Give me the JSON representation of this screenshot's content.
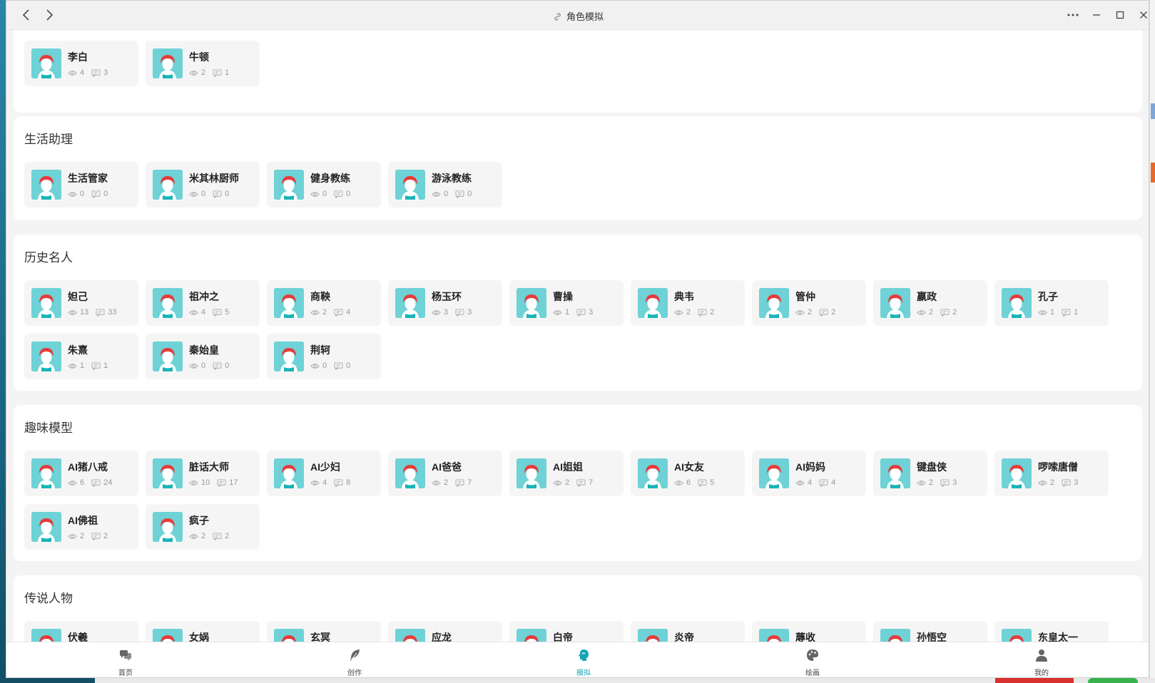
{
  "window": {
    "title": "角色模拟"
  },
  "sections": [
    {
      "title": "",
      "cards": [
        {
          "name": "李白",
          "views": "4",
          "chats": "3"
        },
        {
          "name": "牛顿",
          "views": "2",
          "chats": "1"
        }
      ]
    },
    {
      "title": "生活助理",
      "cards": [
        {
          "name": "生活管家",
          "views": "0",
          "chats": "0"
        },
        {
          "name": "米其林厨师",
          "views": "0",
          "chats": "0"
        },
        {
          "name": "健身教练",
          "views": "0",
          "chats": "0"
        },
        {
          "name": "游泳教练",
          "views": "0",
          "chats": "0"
        }
      ]
    },
    {
      "title": "历史名人",
      "cards": [
        {
          "name": "妲己",
          "views": "13",
          "chats": "33"
        },
        {
          "name": "祖冲之",
          "views": "4",
          "chats": "5"
        },
        {
          "name": "商鞅",
          "views": "2",
          "chats": "4"
        },
        {
          "name": "杨玉环",
          "views": "3",
          "chats": "3"
        },
        {
          "name": "曹操",
          "views": "1",
          "chats": "3"
        },
        {
          "name": "典韦",
          "views": "2",
          "chats": "2"
        },
        {
          "name": "管仲",
          "views": "2",
          "chats": "2"
        },
        {
          "name": "嬴政",
          "views": "2",
          "chats": "2"
        },
        {
          "name": "孔子",
          "views": "1",
          "chats": "1"
        },
        {
          "name": "朱熹",
          "views": "1",
          "chats": "1"
        },
        {
          "name": "秦始皇",
          "views": "0",
          "chats": "0"
        },
        {
          "name": "荆轲",
          "views": "0",
          "chats": "0"
        }
      ]
    },
    {
      "title": "趣味模型",
      "cards": [
        {
          "name": "AI猪八戒",
          "views": "6",
          "chats": "24"
        },
        {
          "name": "脏话大师",
          "views": "10",
          "chats": "17"
        },
        {
          "name": "AI少妇",
          "views": "4",
          "chats": "8"
        },
        {
          "name": "AI爸爸",
          "views": "2",
          "chats": "7"
        },
        {
          "name": "AI姐姐",
          "views": "2",
          "chats": "7"
        },
        {
          "name": "AI女友",
          "views": "6",
          "chats": "5"
        },
        {
          "name": "AI妈妈",
          "views": "4",
          "chats": "4"
        },
        {
          "name": "键盘侠",
          "views": "2",
          "chats": "3"
        },
        {
          "name": "啰嗦唐僧",
          "views": "2",
          "chats": "3"
        },
        {
          "name": "AI佛祖",
          "views": "2",
          "chats": "2"
        },
        {
          "name": "疯子",
          "views": "2",
          "chats": "2"
        }
      ]
    },
    {
      "title": "传说人物",
      "cards": [
        {
          "name": "伏羲",
          "views": "",
          "chats": ""
        },
        {
          "name": "女娲",
          "views": "",
          "chats": ""
        },
        {
          "name": "玄冥",
          "views": "",
          "chats": ""
        },
        {
          "name": "应龙",
          "views": "",
          "chats": ""
        },
        {
          "name": "白帝",
          "views": "",
          "chats": ""
        },
        {
          "name": "炎帝",
          "views": "",
          "chats": ""
        },
        {
          "name": "蓐收",
          "views": "",
          "chats": ""
        },
        {
          "name": "孙悟空",
          "views": "",
          "chats": ""
        },
        {
          "name": "东皇太一",
          "views": "",
          "chats": ""
        }
      ]
    }
  ],
  "tabbar": {
    "active": "roleplay",
    "active_color": "#18a6b4",
    "items": [
      {
        "key": "home",
        "label": "首页",
        "icon": "chat-bubbles-icon"
      },
      {
        "key": "create",
        "label": "创作",
        "icon": "feather-icon"
      },
      {
        "key": "roleplay",
        "label": "模拟",
        "icon": "role-head-icon"
      },
      {
        "key": "paint",
        "label": "绘画",
        "icon": "palette-icon"
      },
      {
        "key": "mine",
        "label": "我的",
        "icon": "user-icon"
      }
    ]
  },
  "colors": {
    "avatar_bg": "#6ed2d6",
    "avatar_hair": "#e63b3b",
    "card_bg": "#f5f5f5",
    "page_bg": "#f4f4f4"
  }
}
